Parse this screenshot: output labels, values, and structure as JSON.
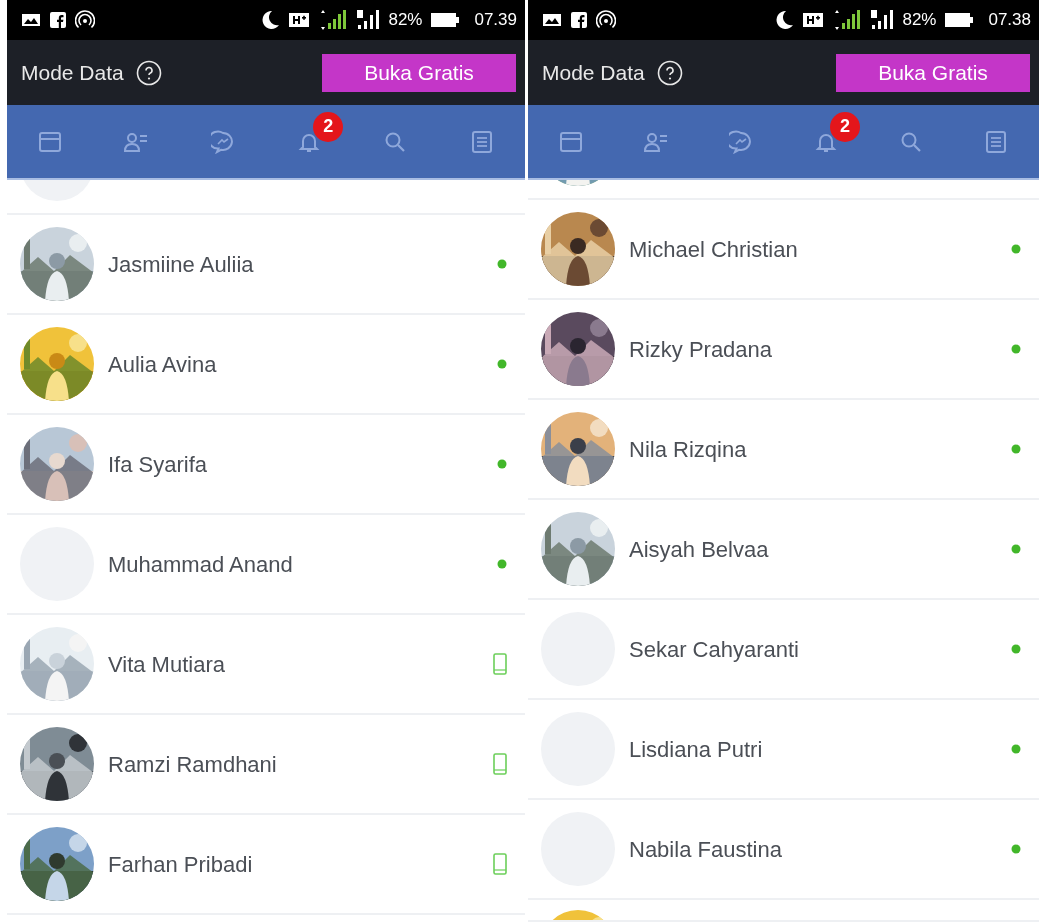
{
  "phones": [
    {
      "status_bar": {
        "battery": "82%",
        "time": "07.39"
      },
      "header": {
        "title": "Mode Data",
        "button": "Buka Gratis"
      },
      "tabs": [
        {
          "kind": "feed",
          "selected": false
        },
        {
          "kind": "friends",
          "selected": false
        },
        {
          "kind": "messenger",
          "selected": false
        },
        {
          "kind": "notifications",
          "selected": false,
          "badge": "2"
        },
        {
          "kind": "search",
          "selected": false
        },
        {
          "kind": "menu",
          "selected": false
        }
      ],
      "contacts": [
        {
          "kind": "partial",
          "photo": false
        },
        {
          "kind": "contact",
          "name": "Jasmiine Auliia",
          "photo": true,
          "on_mobile": false
        },
        {
          "kind": "contact",
          "name": "Aulia Avina",
          "photo": true,
          "on_mobile": false
        },
        {
          "kind": "contact",
          "name": "Ifa Syarifa",
          "photo": true,
          "on_mobile": false
        },
        {
          "kind": "contact",
          "name": "Muhammad Anand",
          "photo": false,
          "on_mobile": false
        },
        {
          "kind": "contact",
          "name": "Vita Mutiara",
          "photo": true,
          "on_mobile": true
        },
        {
          "kind": "contact",
          "name": "Ramzi Ramdhani",
          "photo": true,
          "on_mobile": true
        },
        {
          "kind": "contact",
          "name": "Farhan Pribadi",
          "photo": true,
          "on_mobile": true
        }
      ]
    },
    {
      "status_bar": {
        "battery": "82%",
        "time": "07.38"
      },
      "header": {
        "title": "Mode Data",
        "button": "Buka Gratis"
      },
      "tabs": [
        {
          "kind": "feed",
          "selected": false
        },
        {
          "kind": "friends",
          "selected": false
        },
        {
          "kind": "messenger",
          "selected": false
        },
        {
          "kind": "notifications",
          "selected": false,
          "badge": "2"
        },
        {
          "kind": "search",
          "selected": false
        },
        {
          "kind": "menu",
          "selected": false
        }
      ],
      "contacts": [
        {
          "kind": "partial",
          "photo": true
        },
        {
          "kind": "contact",
          "name": "Michael Christian",
          "photo": true,
          "on_mobile": false
        },
        {
          "kind": "contact",
          "name": "Rizky Pradana",
          "photo": true,
          "on_mobile": false
        },
        {
          "kind": "contact",
          "name": "Nila Rizqina",
          "photo": true,
          "on_mobile": false
        },
        {
          "kind": "contact",
          "name": "Aisyah Belvaa",
          "photo": true,
          "on_mobile": false
        },
        {
          "kind": "contact",
          "name": "Sekar Cahyaranti",
          "photo": false,
          "on_mobile": false
        },
        {
          "kind": "contact",
          "name": "Lisdiana Putri",
          "photo": false,
          "on_mobile": false
        },
        {
          "kind": "contact",
          "name": "Nabila Faustina",
          "photo": false,
          "on_mobile": false
        },
        {
          "kind": "partial",
          "photo": true
        }
      ]
    }
  ]
}
